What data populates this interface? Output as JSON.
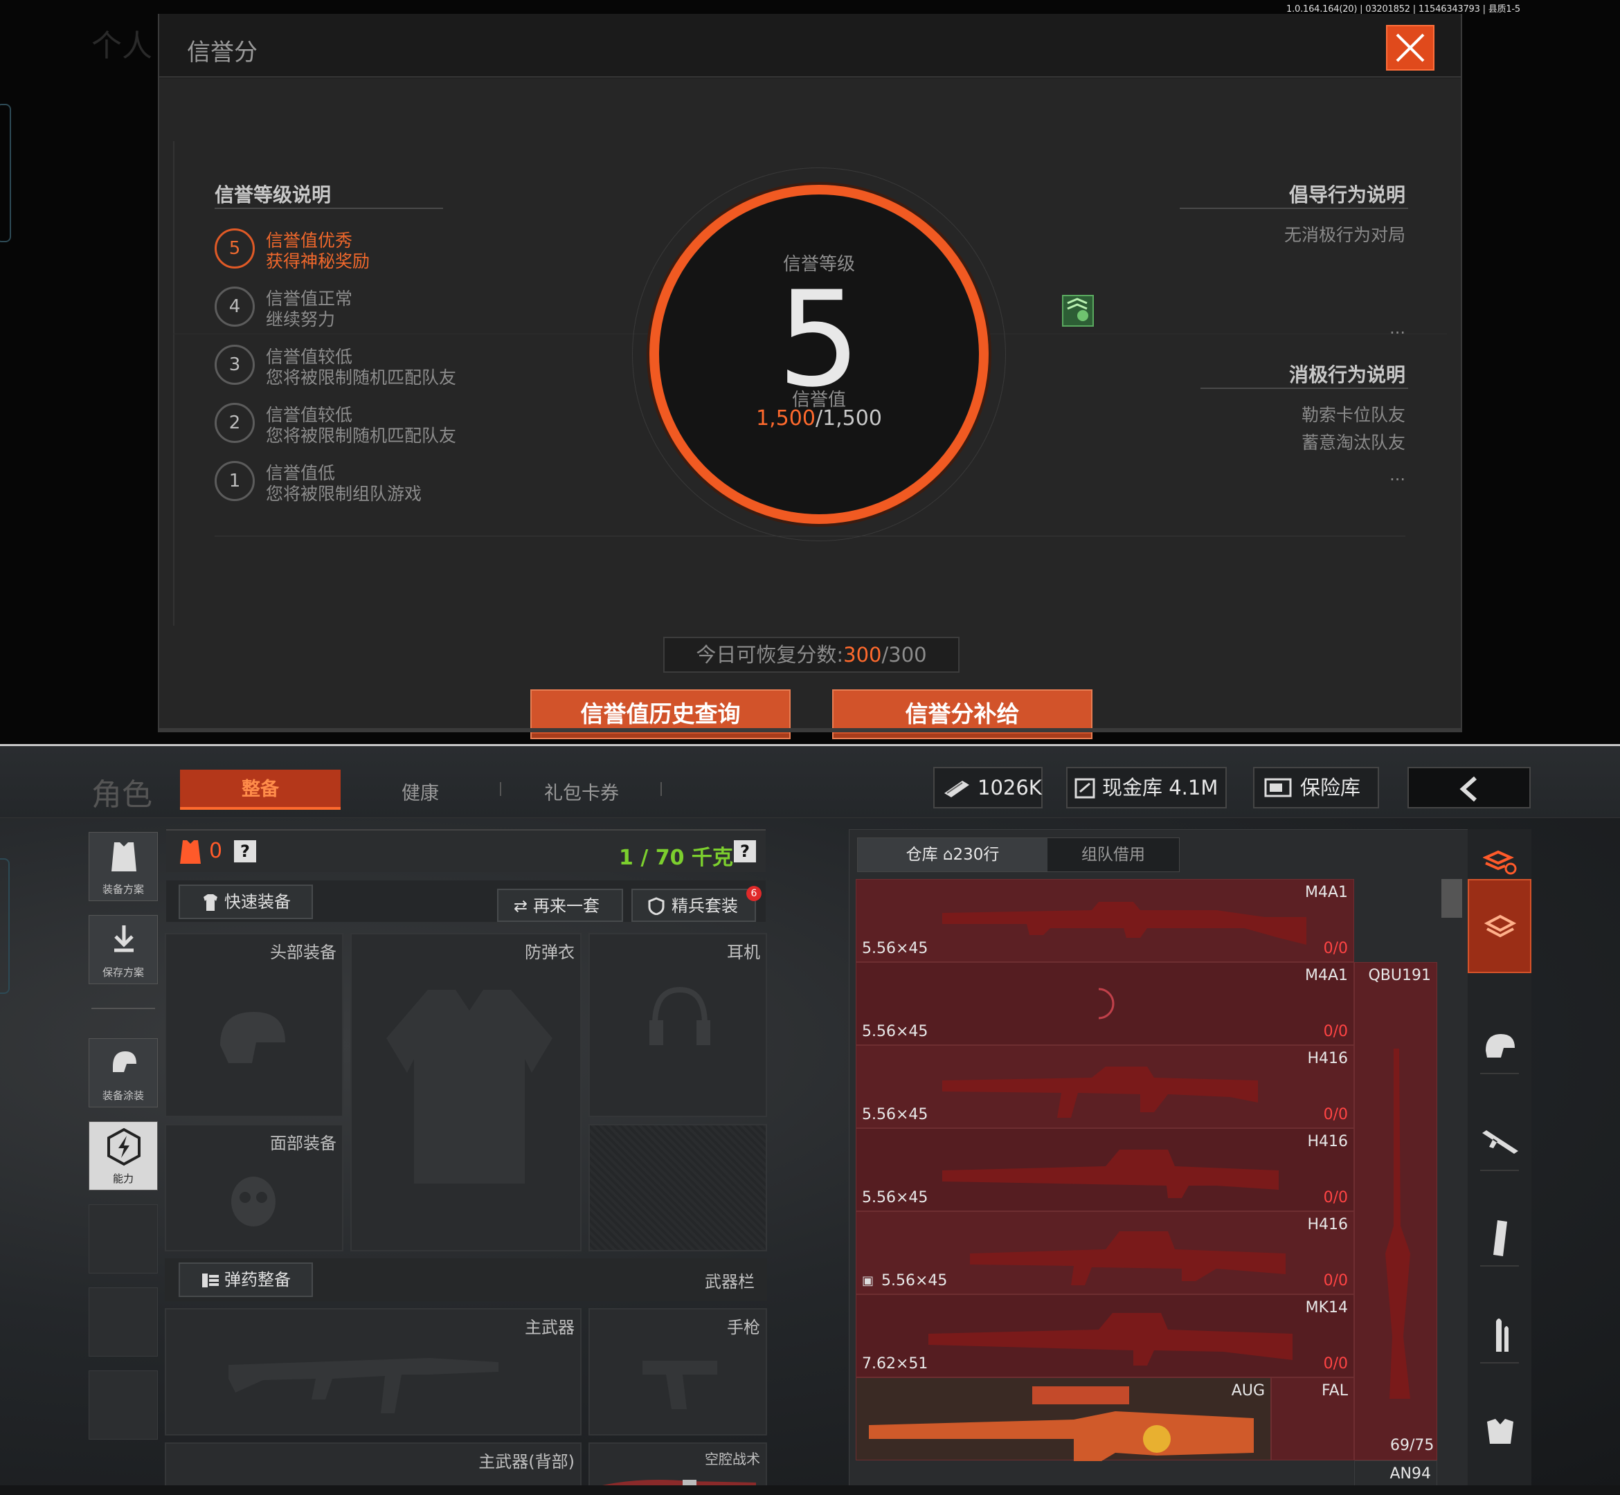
{
  "version": "1.0.164.164(20) | 03201852 | 11546343793 | 县质1-5",
  "top": {
    "bg_title": "个人",
    "dialog_title": "信誉分",
    "left_header": "信誉等级说明",
    "levels": [
      {
        "num": "5",
        "t1": "信誉值优秀",
        "t2": "获得神秘奖励",
        "active": true
      },
      {
        "num": "4",
        "t1": "信誉值正常",
        "t2": "继续努力",
        "active": false
      },
      {
        "num": "3",
        "t1": "信誉值较低",
        "t2": "您将被限制随机匹配队友",
        "active": false
      },
      {
        "num": "2",
        "t1": "信誉值较低",
        "t2": "您将被限制随机匹配队友",
        "active": false
      },
      {
        "num": "1",
        "t1": "信誉值低",
        "t2": "您将被限制组队游戏",
        "active": false
      }
    ],
    "center": {
      "level_label": "信誉等级",
      "level": "5",
      "value_label": "信誉值",
      "value_current": "1,500",
      "value_max": "/1,500"
    },
    "right": {
      "positive_header": "倡导行为说明",
      "positive_items": [
        "无消极行为对局"
      ],
      "negative_header": "消极行为说明",
      "negative_items": [
        "勒索卡位队友",
        "蓄意淘汰队友"
      ],
      "dots": "..."
    },
    "recover": {
      "label": "今日可恢复分数:",
      "current": "300",
      "max": "/300"
    },
    "btn_history": "信誉值历史查询",
    "btn_supply": "信誉分补给"
  },
  "bottom": {
    "role": "角色",
    "tabs": [
      "整备",
      "健康",
      "礼包卡券"
    ],
    "currency1": "1026K",
    "currency2": "现金库 4.1M",
    "currency3": "保险库",
    "side": [
      "装备方案",
      "保存方案",
      "装备涂装",
      "能力"
    ],
    "armor_count": "0",
    "weight": "1 / 70 千克",
    "quick_equip": "快速装备",
    "again": "再来一套",
    "elite": "精兵套装",
    "elite_badge": "6",
    "slots": {
      "head": "头部装备",
      "vest": "防弹衣",
      "ear": "耳机",
      "face": "面部装备",
      "ammo": "弹药整备",
      "weapon_bar": "武器栏",
      "primary": "主武器",
      "pistol": "手枪",
      "primary_back": "主武器(背部)",
      "melee": "空腔战术"
    },
    "inventory": {
      "tab1": "仓库",
      "tab1_count": "230行",
      "tab2": "组队借用",
      "items": [
        {
          "name": "M4A1",
          "cal": "5.56×45",
          "count": "0/0"
        },
        {
          "name": "M4A1",
          "cal": "5.56×45",
          "count": "0/0"
        },
        {
          "name": "H416",
          "cal": "5.56×45",
          "count": "0/0"
        },
        {
          "name": "H416",
          "cal": "5.56×45",
          "count": "0/0"
        },
        {
          "name": "H416",
          "cal": "5.56×45",
          "count": "0/0"
        },
        {
          "name": "MK14",
          "cal": "7.62×51",
          "count": "0/0"
        }
      ],
      "qbu": "QBU191",
      "aug": "AUG",
      "fal": "FAL",
      "fal_count": "69/75",
      "an94": "AN94"
    }
  },
  "colors": {
    "accent": "#f15a22",
    "weight_green": "#7ccf2e",
    "item_red": "#5c2024"
  }
}
